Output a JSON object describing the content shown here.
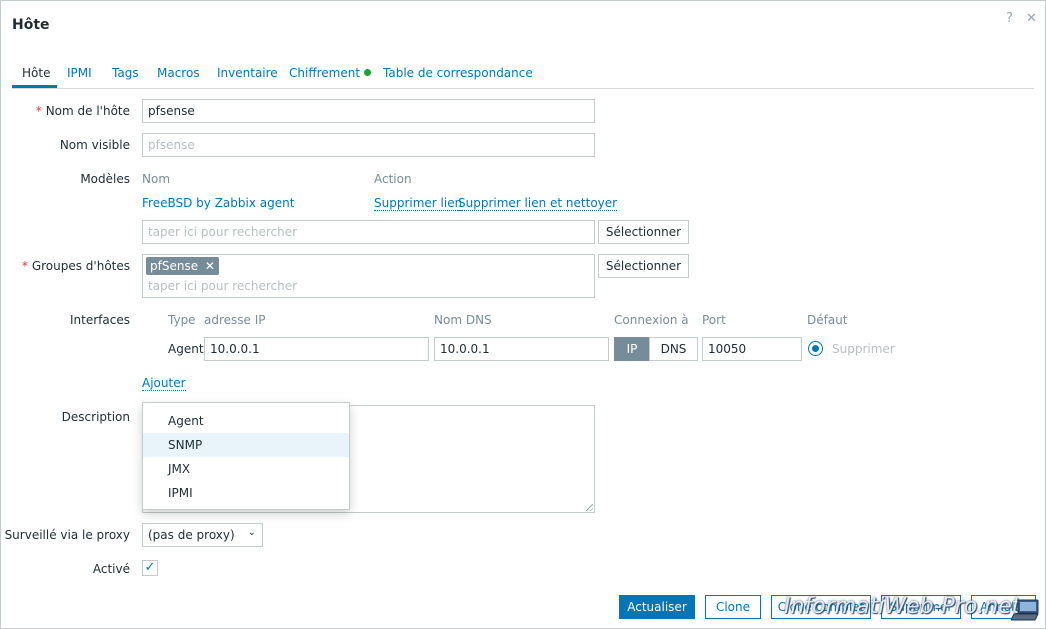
{
  "dialog": {
    "title": "Hôte",
    "help_glyph": "?",
    "close_glyph": "✕"
  },
  "tabs": [
    {
      "label": "Hôte"
    },
    {
      "label": "IPMI"
    },
    {
      "label": "Tags"
    },
    {
      "label": "Macros"
    },
    {
      "label": "Inventaire"
    },
    {
      "label": "Chiffrement"
    },
    {
      "label": "Table de correspondance"
    }
  ],
  "form": {
    "host_name": {
      "label": "Nom de l'hôte",
      "value": "pfsense",
      "required_mark": "*"
    },
    "visible_name": {
      "label": "Nom visible",
      "placeholder": "pfsense"
    },
    "templates": {
      "label": "Modèles",
      "col_name": "Nom",
      "col_action": "Action",
      "rows": [
        {
          "name": "FreeBSD by Zabbix agent",
          "unlink": "Supprimer lien",
          "unlink_clear": "Supprimer lien et nettoyer"
        }
      ],
      "search_placeholder": "taper ici pour rechercher",
      "select_button": "Sélectionner"
    },
    "host_groups": {
      "label": "Groupes d'hôtes",
      "required_mark": "*",
      "chips": [
        "pfSense"
      ],
      "chip_remove": "✕",
      "search_placeholder": "taper ici pour rechercher",
      "select_button": "Sélectionner"
    },
    "interfaces": {
      "label": "Interfaces",
      "headers": {
        "type": "Type",
        "ip": "adresse IP",
        "dns": "Nom DNS",
        "connect": "Connexion à",
        "port": "Port",
        "default": "Défaut"
      },
      "rows": [
        {
          "type": "Agent",
          "ip": "10.0.0.1",
          "dns": "10.0.0.1",
          "connect_ip": "IP",
          "connect_dns": "DNS",
          "port": "10050",
          "remove": "Supprimer"
        }
      ],
      "add_link": "Ajouter",
      "add_menu": [
        "Agent",
        "SNMP",
        "JMX",
        "IPMI"
      ],
      "add_menu_highlighted": "SNMP"
    },
    "description": {
      "label": "Description",
      "value": ""
    },
    "proxy": {
      "label": "Surveillé via le proxy",
      "value": "(pas de proxy)"
    },
    "enabled": {
      "label": "Activé",
      "checked": true
    }
  },
  "footer": {
    "update": "Actualiser",
    "clone": "Clone",
    "full_clone": "Clone complet",
    "delete": "Supprimer",
    "cancel": "Annuler"
  },
  "watermark": "InformatiWeb-Pro.net",
  "colors": {
    "accent": "#0275b8",
    "status_green": "#1aa531",
    "required": "#e33734"
  }
}
